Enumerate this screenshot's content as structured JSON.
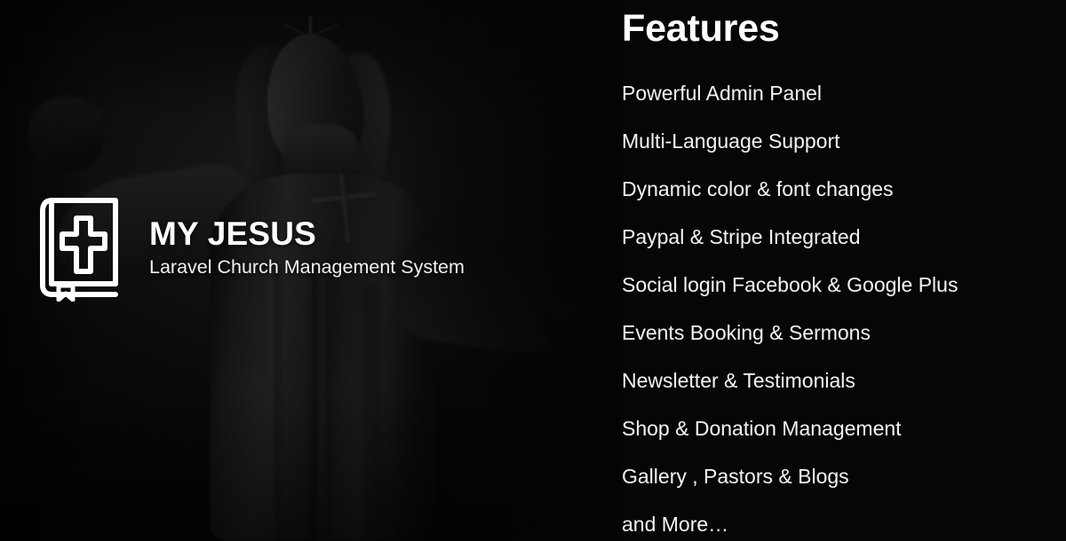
{
  "banner": {
    "background_color": "#050505",
    "accent_color": "#ffffff"
  },
  "brand": {
    "icon": "bible-book-cross-icon",
    "title": "MY JESUS",
    "subtitle": "Laravel Church Management System"
  },
  "artwork": {
    "name": "jesus-statue-silhouette",
    "description": "Dark silhouette of a Christ the Redeemer style statue with outstretched arms"
  },
  "features": {
    "heading": "Features",
    "items": [
      "Powerful Admin Panel",
      "Multi-Language Support",
      "Dynamic color & font changes",
      "Paypal & Stripe Integrated",
      "Social login Facebook & Google Plus",
      "Events Booking & Sermons",
      "Newsletter & Testimonials",
      "Shop & Donation Management",
      "Gallery , Pastors & Blogs",
      "and More…"
    ]
  }
}
